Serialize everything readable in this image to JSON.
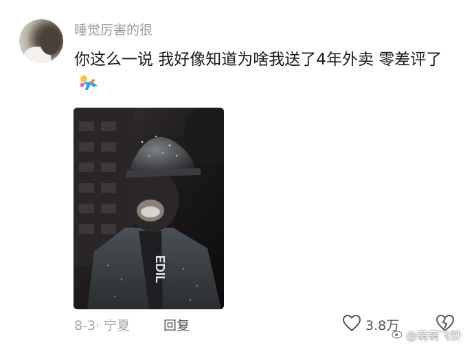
{
  "comment": {
    "username": "睡觉厉害的很",
    "text": "你这么一说  我好像知道为啥我送了4年外卖  零差评了",
    "emoji": "running-emoji",
    "photo_icon": "delivery-rider-photo"
  },
  "footer": {
    "meta": "8-3· 宁夏",
    "reply_label": "回复",
    "like_count": "3.8万"
  },
  "watermark": {
    "text": "@萌萌飞饼"
  },
  "icons": {
    "like": "heart-icon",
    "dislike": "broken-heart-icon"
  }
}
